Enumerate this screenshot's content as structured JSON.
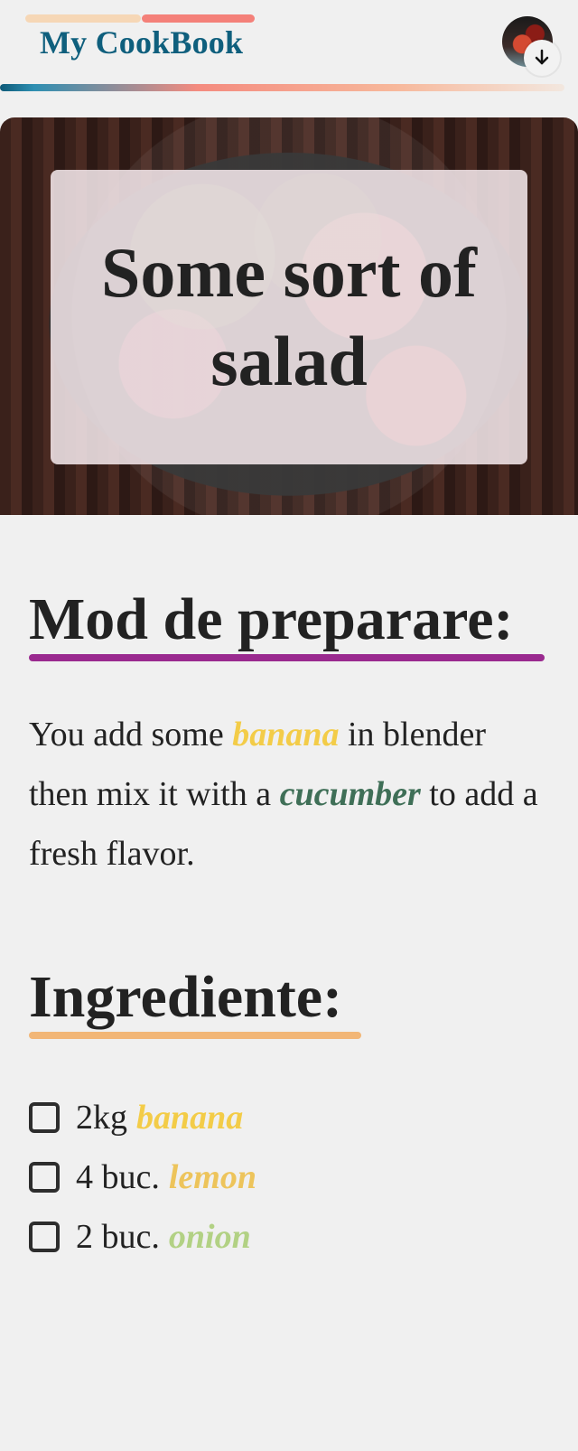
{
  "header": {
    "brand": "My CookBook"
  },
  "hero": {
    "title": "Some sort of salad"
  },
  "sections": {
    "preparation": {
      "title": "Mod de preparare:",
      "text": {
        "part1": "You add some ",
        "keyword1": "banana",
        "part2": " in blender then mix it with a ",
        "keyword2": "cucumber",
        "part3": " to add a fresh flavor."
      }
    },
    "ingredients": {
      "title": "Ingrediente:",
      "items": [
        {
          "qty": "2kg",
          "name": "banana"
        },
        {
          "qty": "4 buc.",
          "name": "lemon"
        },
        {
          "qty": "2 buc.",
          "name": "onion"
        }
      ]
    }
  },
  "colors": {
    "brand": "#0f5f7d",
    "purple_underline": "#9a2a8f",
    "orange_underline": "#f2b676",
    "banana": "#f3cc48",
    "cucumber": "#3f6f57",
    "lemon": "#edc45b",
    "onion": "#b2d184"
  },
  "icons": {
    "download": "arrow-down-icon",
    "checkbox": "checkbox-icon"
  }
}
